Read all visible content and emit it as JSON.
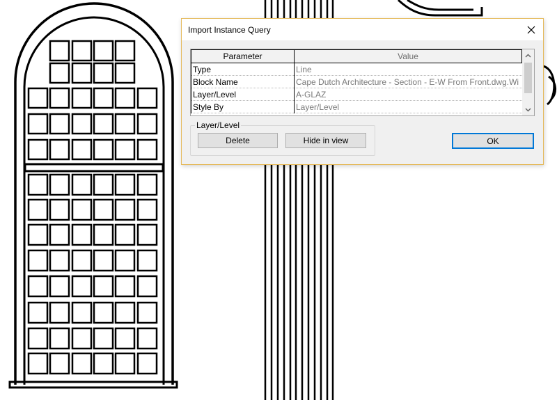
{
  "dialog": {
    "title": "Import Instance Query",
    "close_icon": "close-icon"
  },
  "grid": {
    "headers": [
      "Parameter",
      "Value"
    ],
    "rows": [
      {
        "param": "Type",
        "value": "Line"
      },
      {
        "param": "Block Name",
        "value": "Cape Dutch Architecture - Section - E-W From Front.dwg.Wi"
      },
      {
        "param": "Layer/Level",
        "value": "A-GLAZ"
      },
      {
        "param": "Style By",
        "value": "Layer/Level"
      }
    ]
  },
  "group": {
    "label": "Layer/Level",
    "delete_label": "Delete",
    "hide_label": "Hide in view"
  },
  "ok_label": "OK",
  "colors": {
    "dialog_border": "#e5b95a",
    "ok_border": "#0078d7",
    "cad_lines": "#000000"
  }
}
